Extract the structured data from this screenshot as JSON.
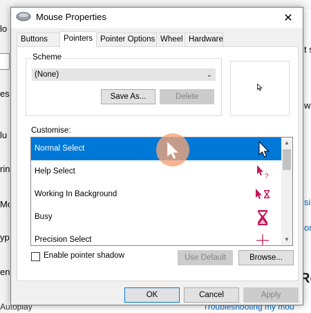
{
  "background": {
    "left_fragments": [
      "lo",
      "es",
      "lu",
      "rin",
      "Mo",
      "yp",
      "en"
    ],
    "right_fragments": [
      "t s",
      "w",
      "siz",
      "ons"
    ],
    "right_title": "Rel",
    "bottom_text": "Autoplay",
    "bottom_link": "Troubleshooting my mou"
  },
  "dialog": {
    "title": "Mouse Properties",
    "tabs": [
      "Buttons",
      "Pointers",
      "Pointer Options",
      "Wheel",
      "Hardware"
    ],
    "active_tab": "Pointers",
    "scheme": {
      "label": "Scheme",
      "selected": "(None)",
      "save_as": "Save As...",
      "delete": "Delete"
    },
    "customise": {
      "label": "Customise:",
      "items": [
        {
          "label": "Normal Select",
          "icon": "arrow-cursor-icon",
          "selected": true
        },
        {
          "label": "Help Select",
          "icon": "help-cursor-icon",
          "selected": false
        },
        {
          "label": "Working In Background",
          "icon": "working-cursor-icon",
          "selected": false
        },
        {
          "label": "Busy",
          "icon": "hourglass-icon",
          "selected": false
        },
        {
          "label": "Precision Select",
          "icon": "crosshair-icon",
          "selected": false
        }
      ]
    },
    "enable_shadow": {
      "label": "Enable pointer shadow",
      "checked": false
    },
    "use_default": "Use Default",
    "browse": "Browse...",
    "ok": "OK",
    "cancel": "Cancel",
    "apply": "Apply"
  },
  "colors": {
    "selection": "#0078d7",
    "cursor_accent": "#c2185b",
    "touch_indicator": "#f4a478"
  }
}
